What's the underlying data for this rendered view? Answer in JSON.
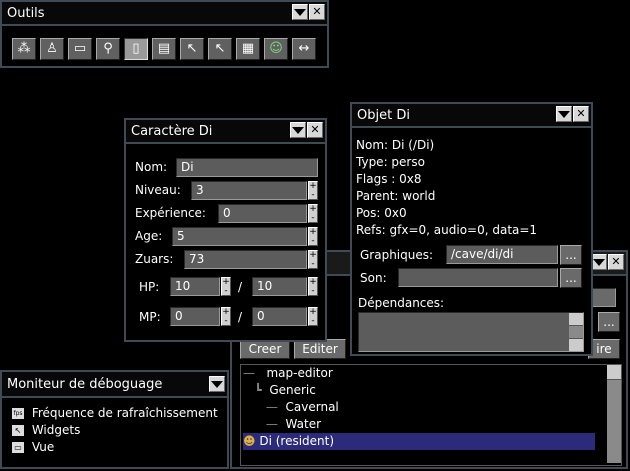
{
  "outils": {
    "title": "Outils",
    "tools": [
      {
        "icon": "nodes-icon",
        "glyph": "⁂"
      },
      {
        "icon": "stamp-icon",
        "glyph": "♙"
      },
      {
        "icon": "eraser-icon",
        "glyph": "▭"
      },
      {
        "icon": "magnifier-icon",
        "glyph": "⚲"
      },
      {
        "icon": "page-icon",
        "glyph": "▯"
      },
      {
        "icon": "pages-icon",
        "glyph": "▤"
      },
      {
        "icon": "pointer-icon",
        "glyph": "↖"
      },
      {
        "icon": "pointer-multi-icon",
        "glyph": "↖"
      },
      {
        "icon": "grid-icon",
        "glyph": "▦"
      },
      {
        "icon": "character-face-icon",
        "glyph": "☺"
      },
      {
        "icon": "horizontal-arrows-icon",
        "glyph": "↔"
      }
    ]
  },
  "caractere": {
    "title": "Caractère Di",
    "nom_label": "Nom:",
    "nom_value": "Di",
    "niveau_label": "Niveau:",
    "niveau_value": "3",
    "experience_label": "Expérience:",
    "experience_value": "0",
    "age_label": "Age:",
    "age_value": "5",
    "zuars_label": "Zuars:",
    "zuars_value": "73",
    "hp_label": "HP:",
    "hp_current": "10",
    "hp_max": "10",
    "mp_label": "MP:",
    "mp_current": "0",
    "mp_max": "0",
    "separator": "/"
  },
  "objet": {
    "title": "Objet Di",
    "lines": [
      "Nom: Di (/Di)",
      "Type: perso",
      "Flags : 0x8",
      "Parent: world",
      "Pos: 0x0",
      "Refs: gfx=0, audio=0, data=1"
    ],
    "graphiques_label": "Graphiques:",
    "graphiques_value": "/cave/di/di",
    "son_label": "Son:",
    "son_value": "",
    "browse_label": "...",
    "dependances_label": "Dépendances:"
  },
  "browser": {
    "creer_label": "Creer",
    "editer_label": "Editer",
    "partial_label": "ire",
    "browse_label": "...",
    "tree": [
      {
        "label": "map-editor",
        "indent": 0,
        "icon": ""
      },
      {
        "label": "Generic",
        "indent": 0,
        "icon": ""
      },
      {
        "label": "Cavernal",
        "indent": 1,
        "icon": ""
      },
      {
        "label": "Water",
        "indent": 1,
        "icon": ""
      },
      {
        "label": "Di (resident)",
        "indent": 0,
        "icon": "character-icon"
      }
    ]
  },
  "moniteur": {
    "title": "Moniteur de déboguage",
    "items": [
      {
        "label": "Fréquence de rafraîchissement",
        "icon": "fps-icon"
      },
      {
        "label": "Widgets",
        "icon": "widgets-icon"
      },
      {
        "label": "Vue",
        "icon": "view-icon"
      }
    ]
  }
}
